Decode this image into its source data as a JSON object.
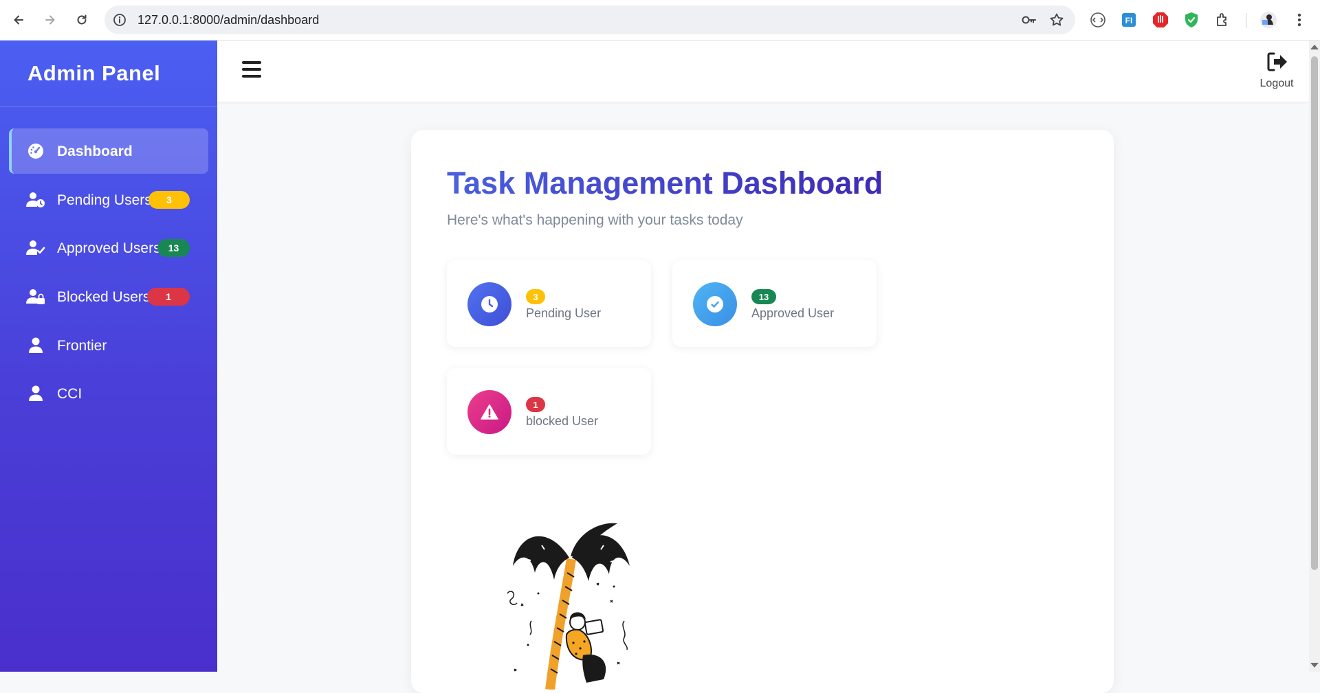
{
  "browser": {
    "url": "127.0.0.1:8000/admin/dashboard",
    "icons": [
      "back-arrow-icon",
      "forward-arrow-icon",
      "reload-icon",
      "site-info-icon",
      "password-key-icon",
      "bookmark-star-icon",
      "extension-icons",
      "profile-avatar",
      "more-menu-icon"
    ]
  },
  "sidebar": {
    "title": "Admin Panel",
    "items": [
      {
        "label": "Dashboard",
        "icon": "speedometer-icon",
        "active": true
      },
      {
        "label": "Pending Users",
        "icon": "user-clock-icon",
        "badge": "3",
        "badge_color": "#ffc107"
      },
      {
        "label": "Approved Users",
        "icon": "user-check-icon",
        "badge": "13",
        "badge_color": "#198754"
      },
      {
        "label": "Blocked Users",
        "icon": "user-lock-icon",
        "badge": "1",
        "badge_color": "#dc3545"
      },
      {
        "label": "Frontier",
        "icon": "user-icon"
      },
      {
        "label": "CCI",
        "icon": "user-icon"
      }
    ]
  },
  "topbar": {
    "logout_label": "Logout"
  },
  "main": {
    "title": "Task Management Dashboard",
    "subtitle": "Here's what's happening with your tasks today",
    "stats": [
      {
        "count": "3",
        "label": "Pending User",
        "icon": "clock-icon",
        "badge_color": "#ffc107"
      },
      {
        "count": "13",
        "label": "Approved User",
        "icon": "check-circle-icon",
        "badge_color": "#198754"
      },
      {
        "count": "1",
        "label": "blocked User",
        "icon": "warning-triangle-icon",
        "badge_color": "#dc3545"
      }
    ]
  },
  "colors": {
    "sidebar_gradient_top": "#4b5ff2",
    "sidebar_gradient_bottom": "#4a2fcc",
    "title_gradient": [
      "#4a5fe0",
      "#3d2bb5"
    ]
  }
}
